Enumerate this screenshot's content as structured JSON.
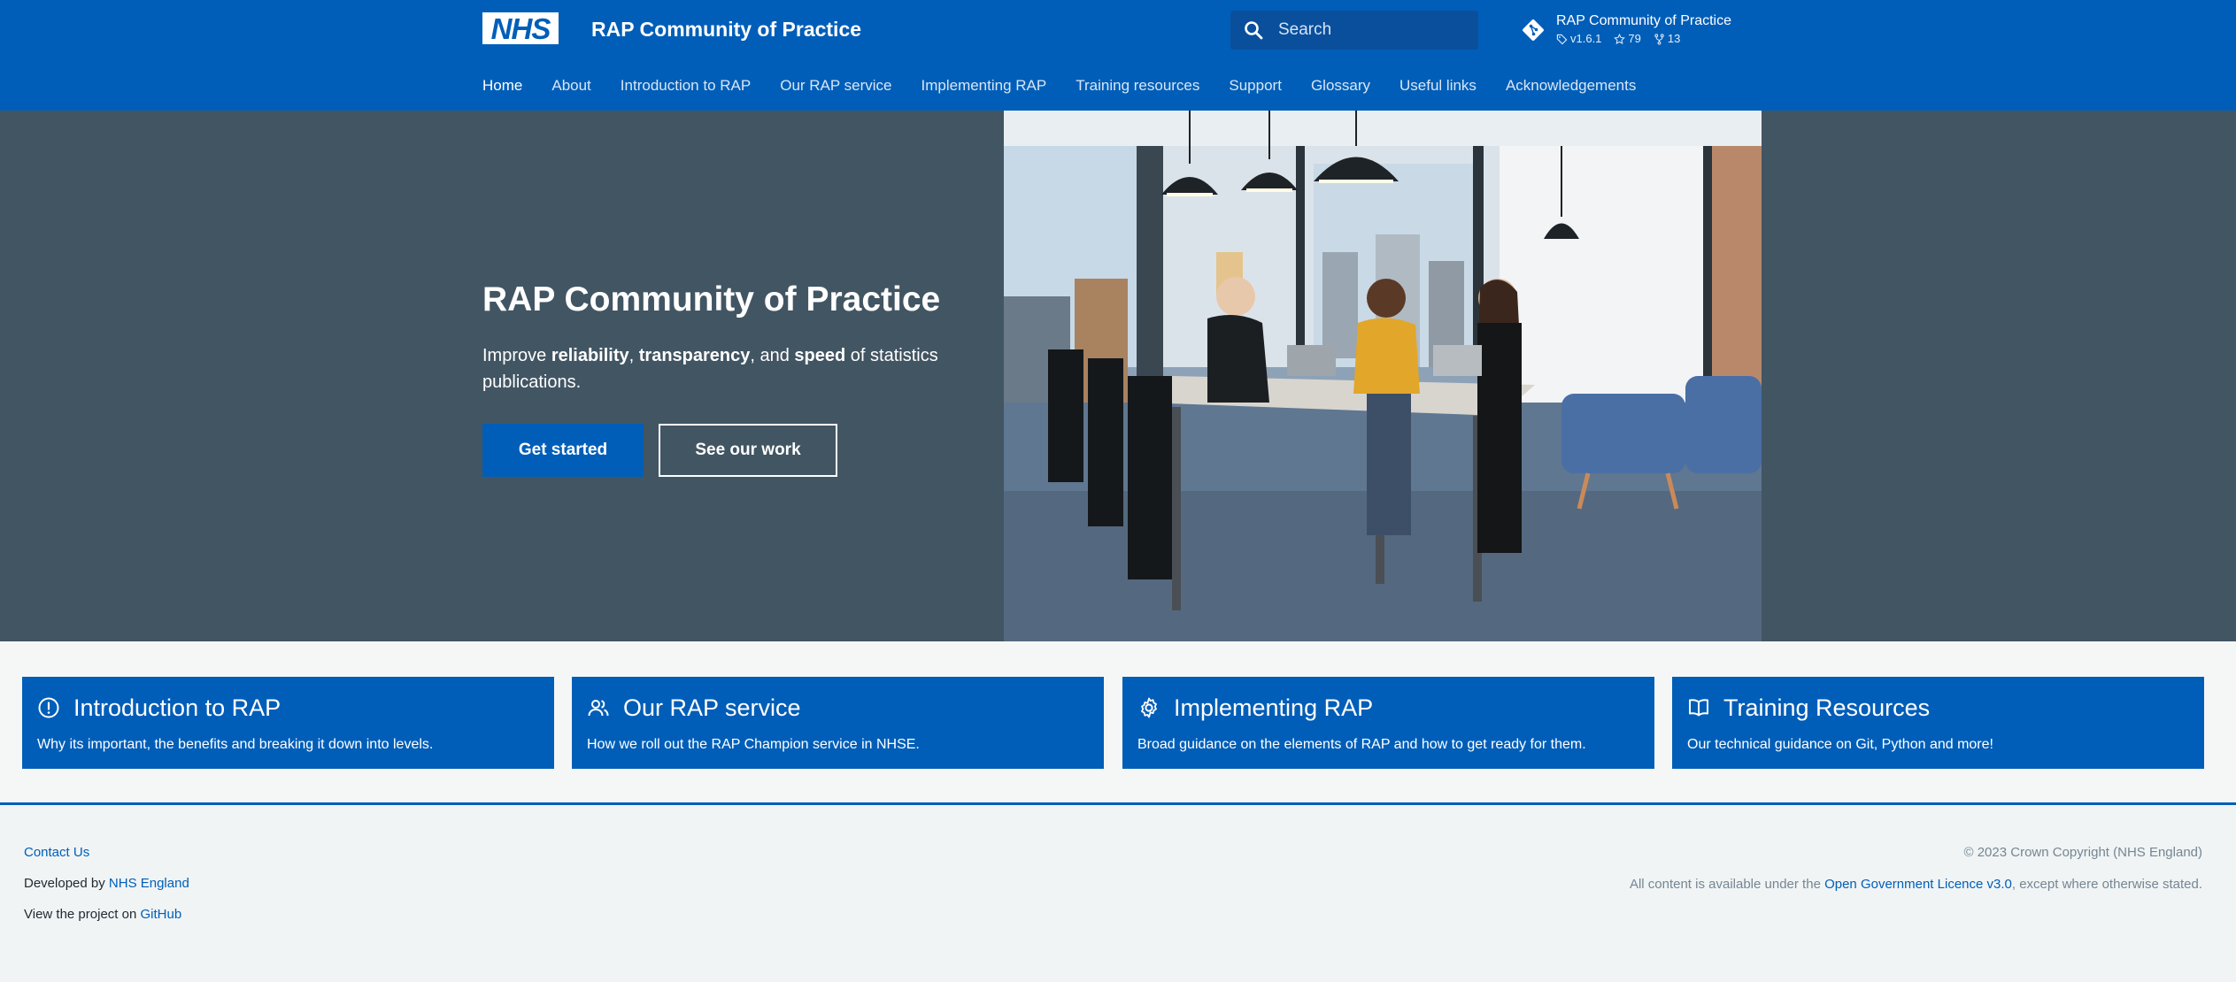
{
  "header": {
    "logo_text": "NHS",
    "site_title": "RAP Community of Practice",
    "search_placeholder": "Search",
    "repo": {
      "name": "RAP Community of Practice",
      "version": "v1.6.1",
      "stars": "79",
      "forks": "13"
    }
  },
  "nav": {
    "tabs": [
      {
        "label": "Home",
        "active": true
      },
      {
        "label": "About"
      },
      {
        "label": "Introduction to RAP"
      },
      {
        "label": "Our RAP service"
      },
      {
        "label": "Implementing RAP"
      },
      {
        "label": "Training resources"
      },
      {
        "label": "Support"
      },
      {
        "label": "Glossary"
      },
      {
        "label": "Useful links"
      },
      {
        "label": "Acknowledgements"
      }
    ]
  },
  "hero": {
    "title": "RAP Community of Practice",
    "lead": {
      "p1": "Improve ",
      "b1": "reliability",
      "p2": ", ",
      "b2": "transparency",
      "p3": ", and ",
      "b3": "speed",
      "p4": " of statistics publications."
    },
    "primary_button": "Get started",
    "secondary_button": "See our work"
  },
  "cards": [
    {
      "icon": "alert-circle-icon",
      "title": "Introduction to RAP",
      "description": "Why its important, the benefits and breaking it down into levels."
    },
    {
      "icon": "people-icon",
      "title": "Our RAP service",
      "description": "How we roll out the RAP Champion service in NHSE."
    },
    {
      "icon": "gear-icon",
      "title": "Implementing RAP",
      "description": "Broad guidance on the elements of RAP and how to get ready for them."
    },
    {
      "icon": "book-icon",
      "title": "Training Resources",
      "description": "Our technical guidance on Git, Python and more!"
    }
  ],
  "footer": {
    "contact": "Contact Us",
    "developed_prefix": "Developed by ",
    "developed_link": "NHS England",
    "project_prefix": "View the project on ",
    "project_link": "GitHub",
    "copyright": "© 2023 Crown Copyright (NHS England)",
    "licence_prefix": "All content is available under the ",
    "licence_link": "Open Government Licence v3.0",
    "licence_suffix": ", except where otherwise stated."
  },
  "colors": {
    "brand_blue": "#005eb8",
    "hero_bg": "#425563",
    "page_bg": "#f5f7f7"
  }
}
